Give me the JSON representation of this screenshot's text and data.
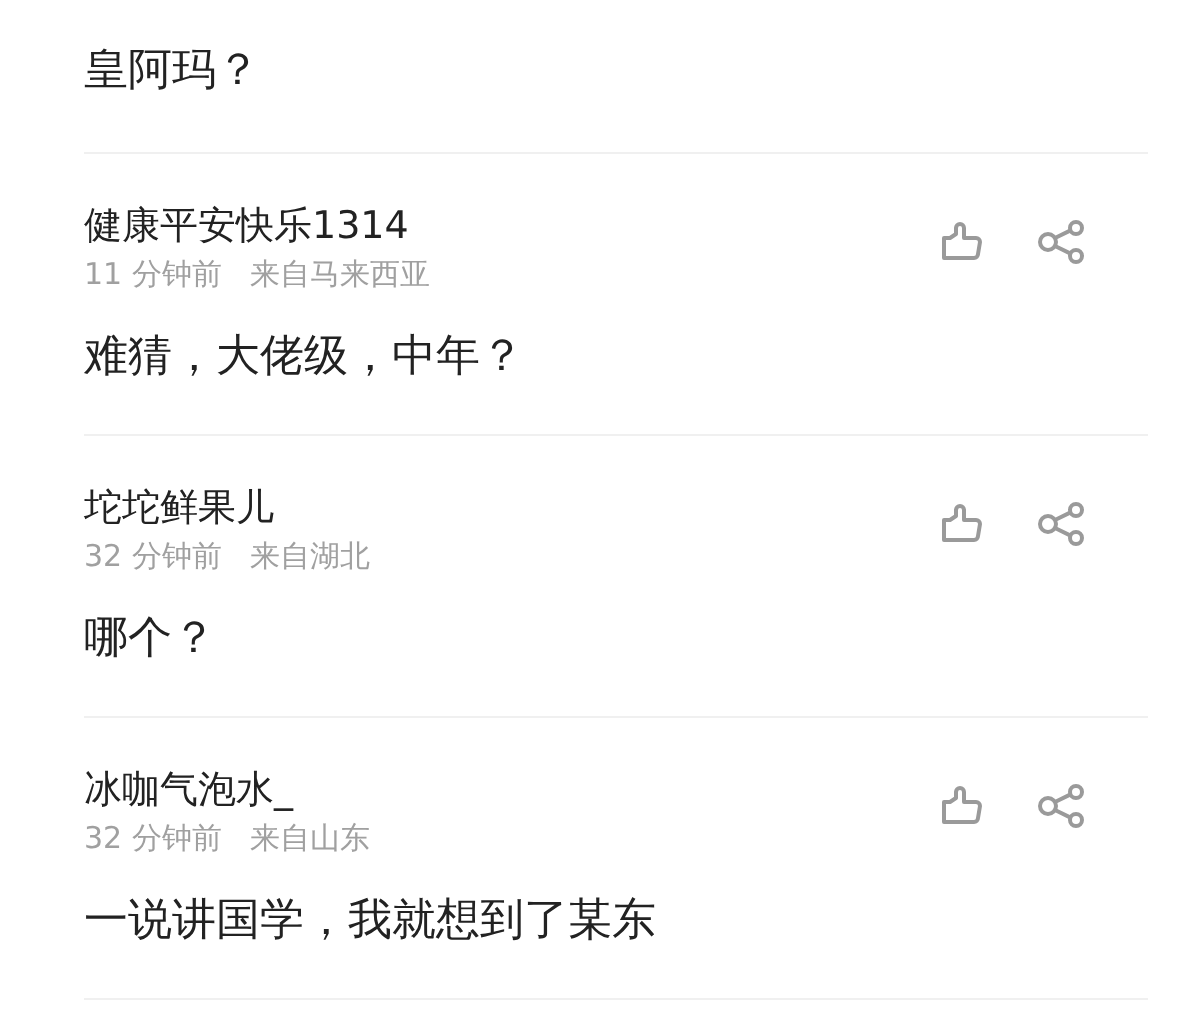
{
  "first_comment": {
    "content": "皇阿玛？"
  },
  "comments": [
    {
      "name": "健康平安快乐1314",
      "time": "11 分钟前",
      "location": "来自马来西亚",
      "content": "难猜，大佬级，中年？"
    },
    {
      "name": "坨坨鲜果儿",
      "time": "32 分钟前",
      "location": "来自湖北",
      "content": "哪个？"
    },
    {
      "name": "冰咖气泡水_",
      "time": "32 分钟前",
      "location": "来自山东",
      "content": "一说讲国学，我就想到了某东"
    }
  ]
}
